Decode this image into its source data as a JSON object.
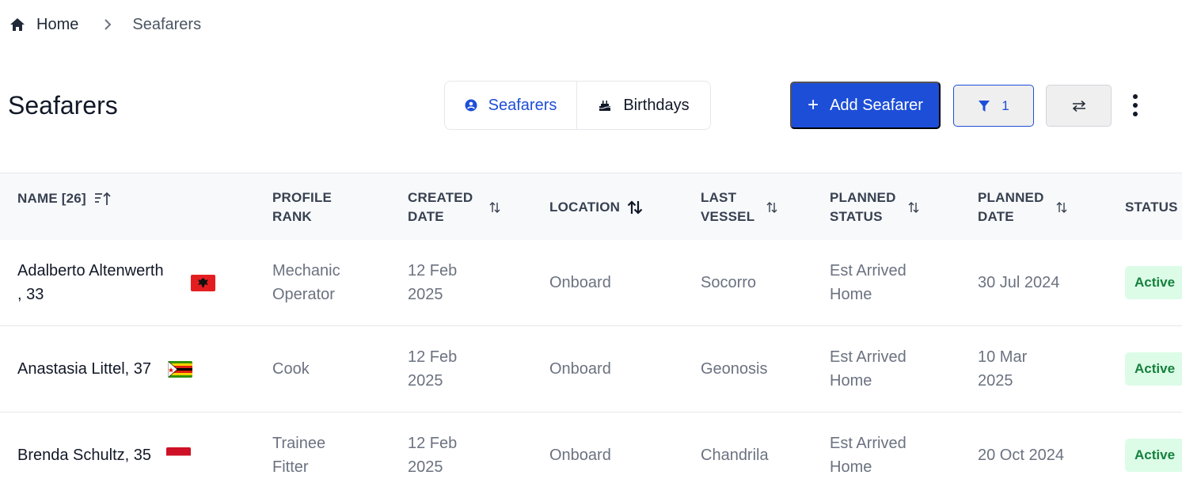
{
  "breadcrumb": {
    "home_icon": "home-icon",
    "home_label": "Home",
    "separator_icon": "chevron-right-icon",
    "current_label": "Seafarers"
  },
  "page": {
    "title": "Seafarers"
  },
  "view_toggle": {
    "items": [
      {
        "label": "Seafarers",
        "icon": "user-circle-icon",
        "active": true
      },
      {
        "label": "Birthdays",
        "icon": "birthday-cake-icon",
        "active": false
      }
    ]
  },
  "toolbar": {
    "add_label": "Add Seafarer",
    "add_icon": "plus-icon",
    "filter_icon": "filter-icon",
    "filter_count": "1",
    "swap_icon": "swap-arrows-icon",
    "more_icon": "more-vertical-icon"
  },
  "colors": {
    "primary": "#1d4ed8",
    "status_active_bg": "#dcfce7",
    "status_active_text": "#15803d",
    "header_bg": "#f8f9fb"
  },
  "table": {
    "columns": [
      {
        "line1": "NAME [26]",
        "line2": "",
        "sort": "sort-ascending-icon"
      },
      {
        "line1": "PROFILE",
        "line2": "RANK",
        "sort": ""
      },
      {
        "line1": "CREATED",
        "line2": "DATE",
        "sort": "sort-icon"
      },
      {
        "line1": "LOCATION",
        "line2": "",
        "sort": "sort-icon-bold"
      },
      {
        "line1": "LAST",
        "line2": "VESSEL",
        "sort": "sort-icon"
      },
      {
        "line1": "PLANNED",
        "line2": "STATUS",
        "sort": "sort-icon"
      },
      {
        "line1": "PLANNED",
        "line2": "DATE",
        "sort": "sort-icon"
      },
      {
        "line1": "STATUS",
        "line2": "",
        "sort": ""
      }
    ],
    "rows": [
      {
        "name_line1": "Adalberto Altenwerth",
        "name_line2": ", 33",
        "flag": "albania-flag",
        "rank_line1": "Mechanic",
        "rank_line2": "Operator",
        "created_line1": "12 Feb",
        "created_line2": "2025",
        "location": "Onboard",
        "vessel": "Socorro",
        "planned_status_line1": "Est Arrived",
        "planned_status_line2": "Home",
        "planned_date_line1": "30 Jul 2024",
        "planned_date_line2": "",
        "status": "Active"
      },
      {
        "name_line1": "Anastasia Littel, 37",
        "name_line2": "",
        "flag": "zimbabwe-flag",
        "rank_line1": "Cook",
        "rank_line2": "",
        "created_line1": "12 Feb",
        "created_line2": "2025",
        "location": "Onboard",
        "vessel": "Geonosis",
        "planned_status_line1": "Est Arrived",
        "planned_status_line2": "Home",
        "planned_date_line1": "10 Mar",
        "planned_date_line2": "2025",
        "status": "Active"
      },
      {
        "name_line1": "Brenda Schultz, 35",
        "name_line2": "",
        "flag": "indonesia-flag",
        "rank_line1": "Trainee",
        "rank_line2": "Fitter",
        "created_line1": "12 Feb",
        "created_line2": "2025",
        "location": "Onboard",
        "vessel": "Chandrila",
        "planned_status_line1": "Est Arrived",
        "planned_status_line2": "Home",
        "planned_date_line1": "20 Oct 2024",
        "planned_date_line2": "",
        "status": "Active"
      }
    ]
  }
}
